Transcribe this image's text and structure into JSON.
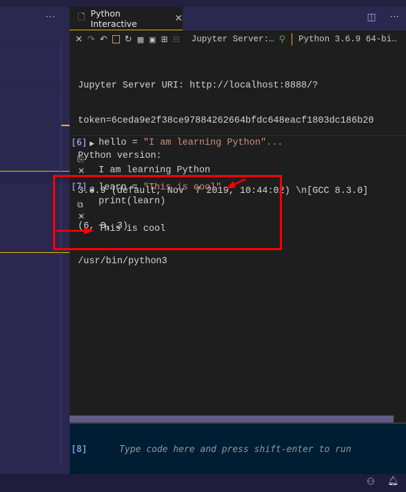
{
  "left_panel": {
    "more_label": "···"
  },
  "tab": {
    "label": "Python Interactive",
    "close": "✕"
  },
  "tab_actions": {
    "split": "◫",
    "more": "···"
  },
  "toolbar": {
    "icons": [
      "close-icon",
      "undo-icon",
      "redo-icon",
      "stop-icon",
      "restart-icon",
      "variables-icon",
      "save-icon",
      "expand-all-icon",
      "collapse-all-icon"
    ],
    "server_label": "Jupyter Server:…",
    "kernel_label": "Python 3.6.9 64-bi…"
  },
  "sysinfo": {
    "lines": [
      "Jupyter Server URI: http://localhost:8888/?",
      "token=6ceda9e2f38ce97884262664bfdc648eacf1803dc186b20",
      "Python version:",
      "3.6.9 (default, Nov  7 2019, 10:44:02) \\n[GCC 8.3.0]",
      "(6, 0, 3)",
      "/usr/bin/python3"
    ]
  },
  "cells": [
    {
      "number": "[6]",
      "var": "hello",
      "op": " = ",
      "str": "\"I am learning Python\"...",
      "output": "I am learning Python"
    },
    {
      "number": "[7]",
      "var": "learn",
      "op": " = ",
      "str": "\"This is cool\"",
      "line2": "print(learn)",
      "output": "This is cool"
    }
  ],
  "input": {
    "number": "[8]",
    "placeholder": "Type code here and press shift-enter to run"
  },
  "colors": {
    "accent": "#e5c400",
    "annotation": "#ff0000",
    "string": "#ce9178",
    "cell_number": "#8c8fd6"
  }
}
